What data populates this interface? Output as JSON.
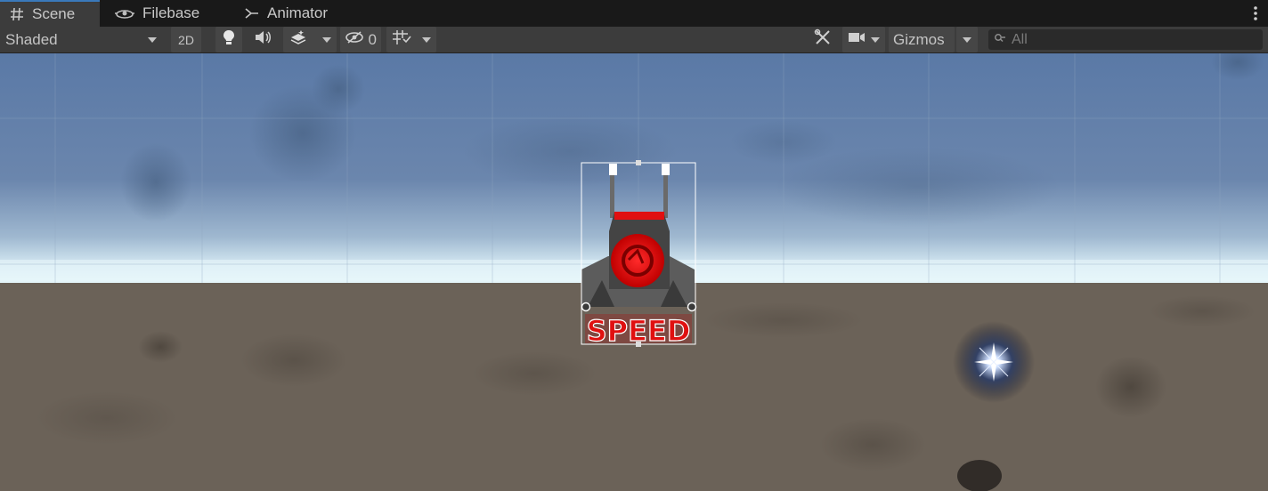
{
  "tabs": [
    {
      "label": "Scene",
      "icon": "hash-icon",
      "active": true
    },
    {
      "label": "Filebase",
      "icon": "filebase-icon",
      "active": false
    },
    {
      "label": "Animator",
      "icon": "animator-icon",
      "active": false
    }
  ],
  "toolbar": {
    "shading_mode": "Shaded",
    "mode_2d": "2D",
    "hidden_count": "0",
    "gizmos_label": "Gizmos",
    "search_placeholder": "All"
  },
  "scene": {
    "selected_object_label": "SPEED",
    "colors": {
      "sky_top": "#5a79a6",
      "horizon": "#d8eef5",
      "ground": "#6b6258",
      "accent_red": "#e01010",
      "selection": "#ffffff"
    }
  }
}
